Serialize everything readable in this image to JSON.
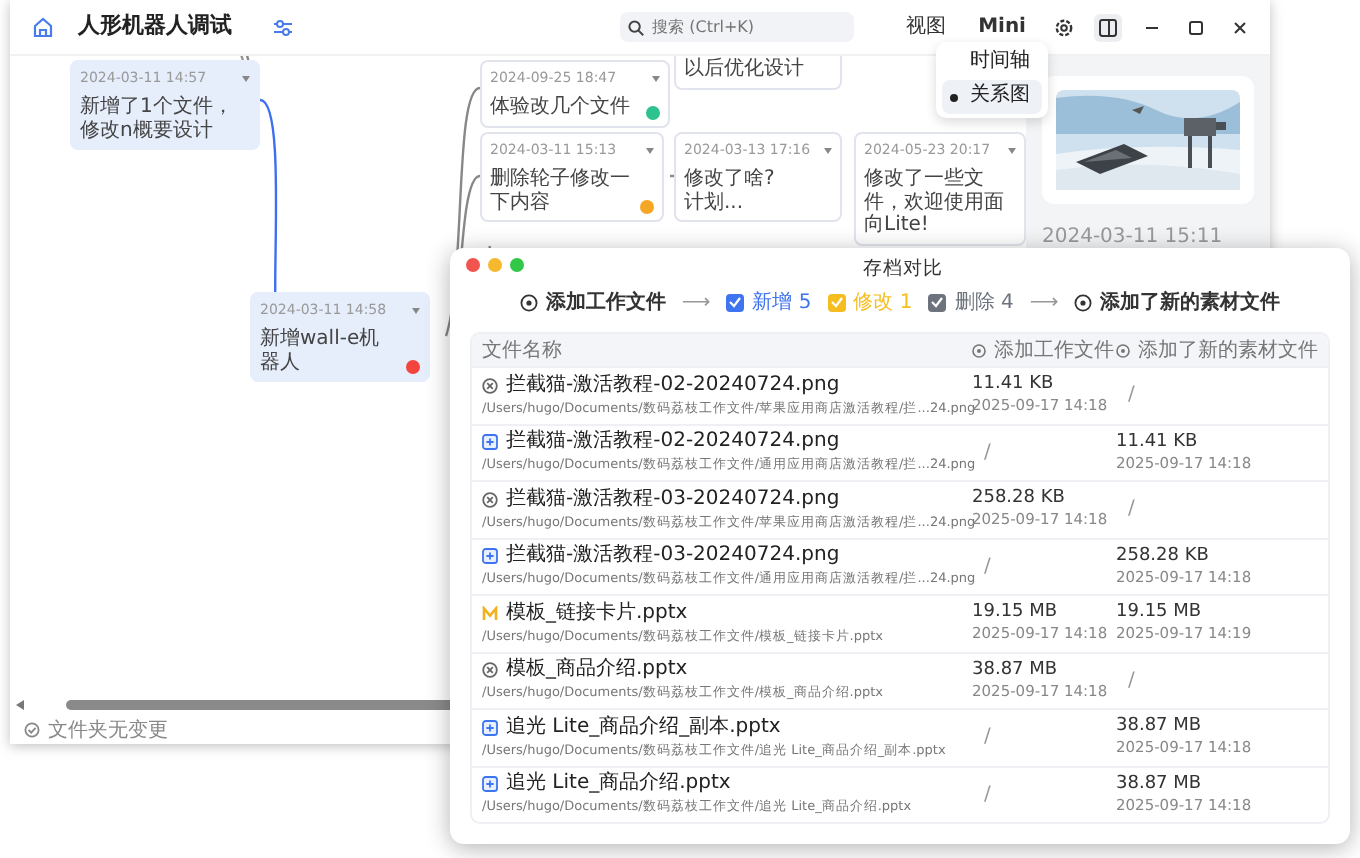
{
  "app": {
    "title": "人形机器人调试"
  },
  "search": {
    "placeholder": "搜索 (Ctrl+K)"
  },
  "toolbar": {
    "view_button": "视图",
    "mini_button": "Mini",
    "panel_toggle": {
      "on": true
    }
  },
  "view_menu": [
    {
      "label": "时间轴",
      "selected": false
    },
    {
      "label": "关系图",
      "selected": true
    }
  ],
  "graph": {
    "nodes": [
      {
        "text": "以后优化设计",
        "selected": false
      },
      {
        "date": "2024-03-11 14:57",
        "text": "新增了1个文件，修改n概要设计",
        "selected": true
      },
      {
        "date": "2024-09-25 18:47",
        "text": "体验改几个文件",
        "selected": false,
        "color": "#2ec28e"
      },
      {
        "date": "2024-03-11 15:13",
        "text": "删除轮子修改一下内容",
        "selected": false,
        "color": "#f5a623"
      },
      {
        "date": "2024-03-13 17:16",
        "text": "修改了啥?\n计划...",
        "selected": false
      },
      {
        "date": "2024-05-23 20:17",
        "text": "修改了一些文件，欢迎使用面向Lite!",
        "selected": false
      },
      {
        "date": "2024-03-11 14:58",
        "text": "新增wall-e机器人",
        "selected": true,
        "color": "#f2453d"
      }
    ]
  },
  "detail": {
    "date": "2024-03-11 15:11"
  },
  "status_bar": "文件夹无变更",
  "dialog": {
    "title": "存档对比",
    "legend": {
      "source": "添加工作文件",
      "arrow_1": "⟶",
      "arrow_2": "⟶",
      "target": "添加了新的素材文件",
      "items": [
        {
          "kind": "added",
          "label": "新增 5",
          "checked": true
        },
        {
          "kind": "modified",
          "label": "修改 1",
          "checked": true
        },
        {
          "kind": "removed",
          "label": "删除 4",
          "checked": true
        }
      ]
    },
    "columns": [
      "文件名称",
      "添加工作文件",
      "添加了新的素材文件"
    ],
    "rows": [
      {
        "kind": "removed",
        "name": "拦截猫-激活教程-02-20240724.png",
        "path": "/Users/hugo/Documents/数码荔枝工作文件/苹果应用商店激活教程/拦...24.png",
        "left": [
          "11.41 KB",
          "2025-09-17 14:18"
        ],
        "right": [
          "/"
        ]
      },
      {
        "kind": "added",
        "name": "拦截猫-激活教程-02-20240724.png",
        "path": "/Users/hugo/Documents/数码荔枝工作文件/通用应用商店激活教程/拦...24.png",
        "left": [
          "/"
        ],
        "right": [
          "11.41 KB",
          "2025-09-17 14:18"
        ]
      },
      {
        "kind": "removed",
        "name": "拦截猫-激活教程-03-20240724.png",
        "path": "/Users/hugo/Documents/数码荔枝工作文件/苹果应用商店激活教程/拦...24.png",
        "left": [
          "258.28 KB",
          "2025-09-17 14:18"
        ],
        "right": [
          "/"
        ]
      },
      {
        "kind": "added",
        "name": "拦截猫-激活教程-03-20240724.png",
        "path": "/Users/hugo/Documents/数码荔枝工作文件/通用应用商店激活教程/拦...24.png",
        "left": [
          "/"
        ],
        "right": [
          "258.28 KB",
          "2025-09-17 14:18"
        ]
      },
      {
        "kind": "modified",
        "name": "模板_链接卡片.pptx",
        "path": "/Users/hugo/Documents/数码荔枝工作文件/模板_链接卡片.pptx",
        "left": [
          "19.15 MB",
          "2025-09-17 14:18"
        ],
        "right": [
          "19.15 MB",
          "2025-09-17 14:19"
        ]
      },
      {
        "kind": "removed",
        "name": "模板_商品介绍.pptx",
        "path": "/Users/hugo/Documents/数码荔枝工作文件/模板_商品介绍.pptx",
        "left": [
          "38.87 MB",
          "2025-09-17 14:18"
        ],
        "right": [
          "/"
        ]
      },
      {
        "kind": "added",
        "name": "追光 Lite_商品介绍_副本.pptx",
        "path": "/Users/hugo/Documents/数码荔枝工作文件/追光 Lite_商品介绍_副本.pptx",
        "left": [
          "/"
        ],
        "right": [
          "38.87 MB",
          "2025-09-17 14:18"
        ]
      },
      {
        "kind": "added",
        "name": "追光 Lite_商品介绍.pptx",
        "path": "/Users/hugo/Documents/数码荔枝工作文件/追光 Lite_商品介绍.pptx",
        "left": [
          "/"
        ],
        "right": [
          "38.87 MB",
          "2025-09-17 14:18"
        ]
      }
    ]
  }
}
